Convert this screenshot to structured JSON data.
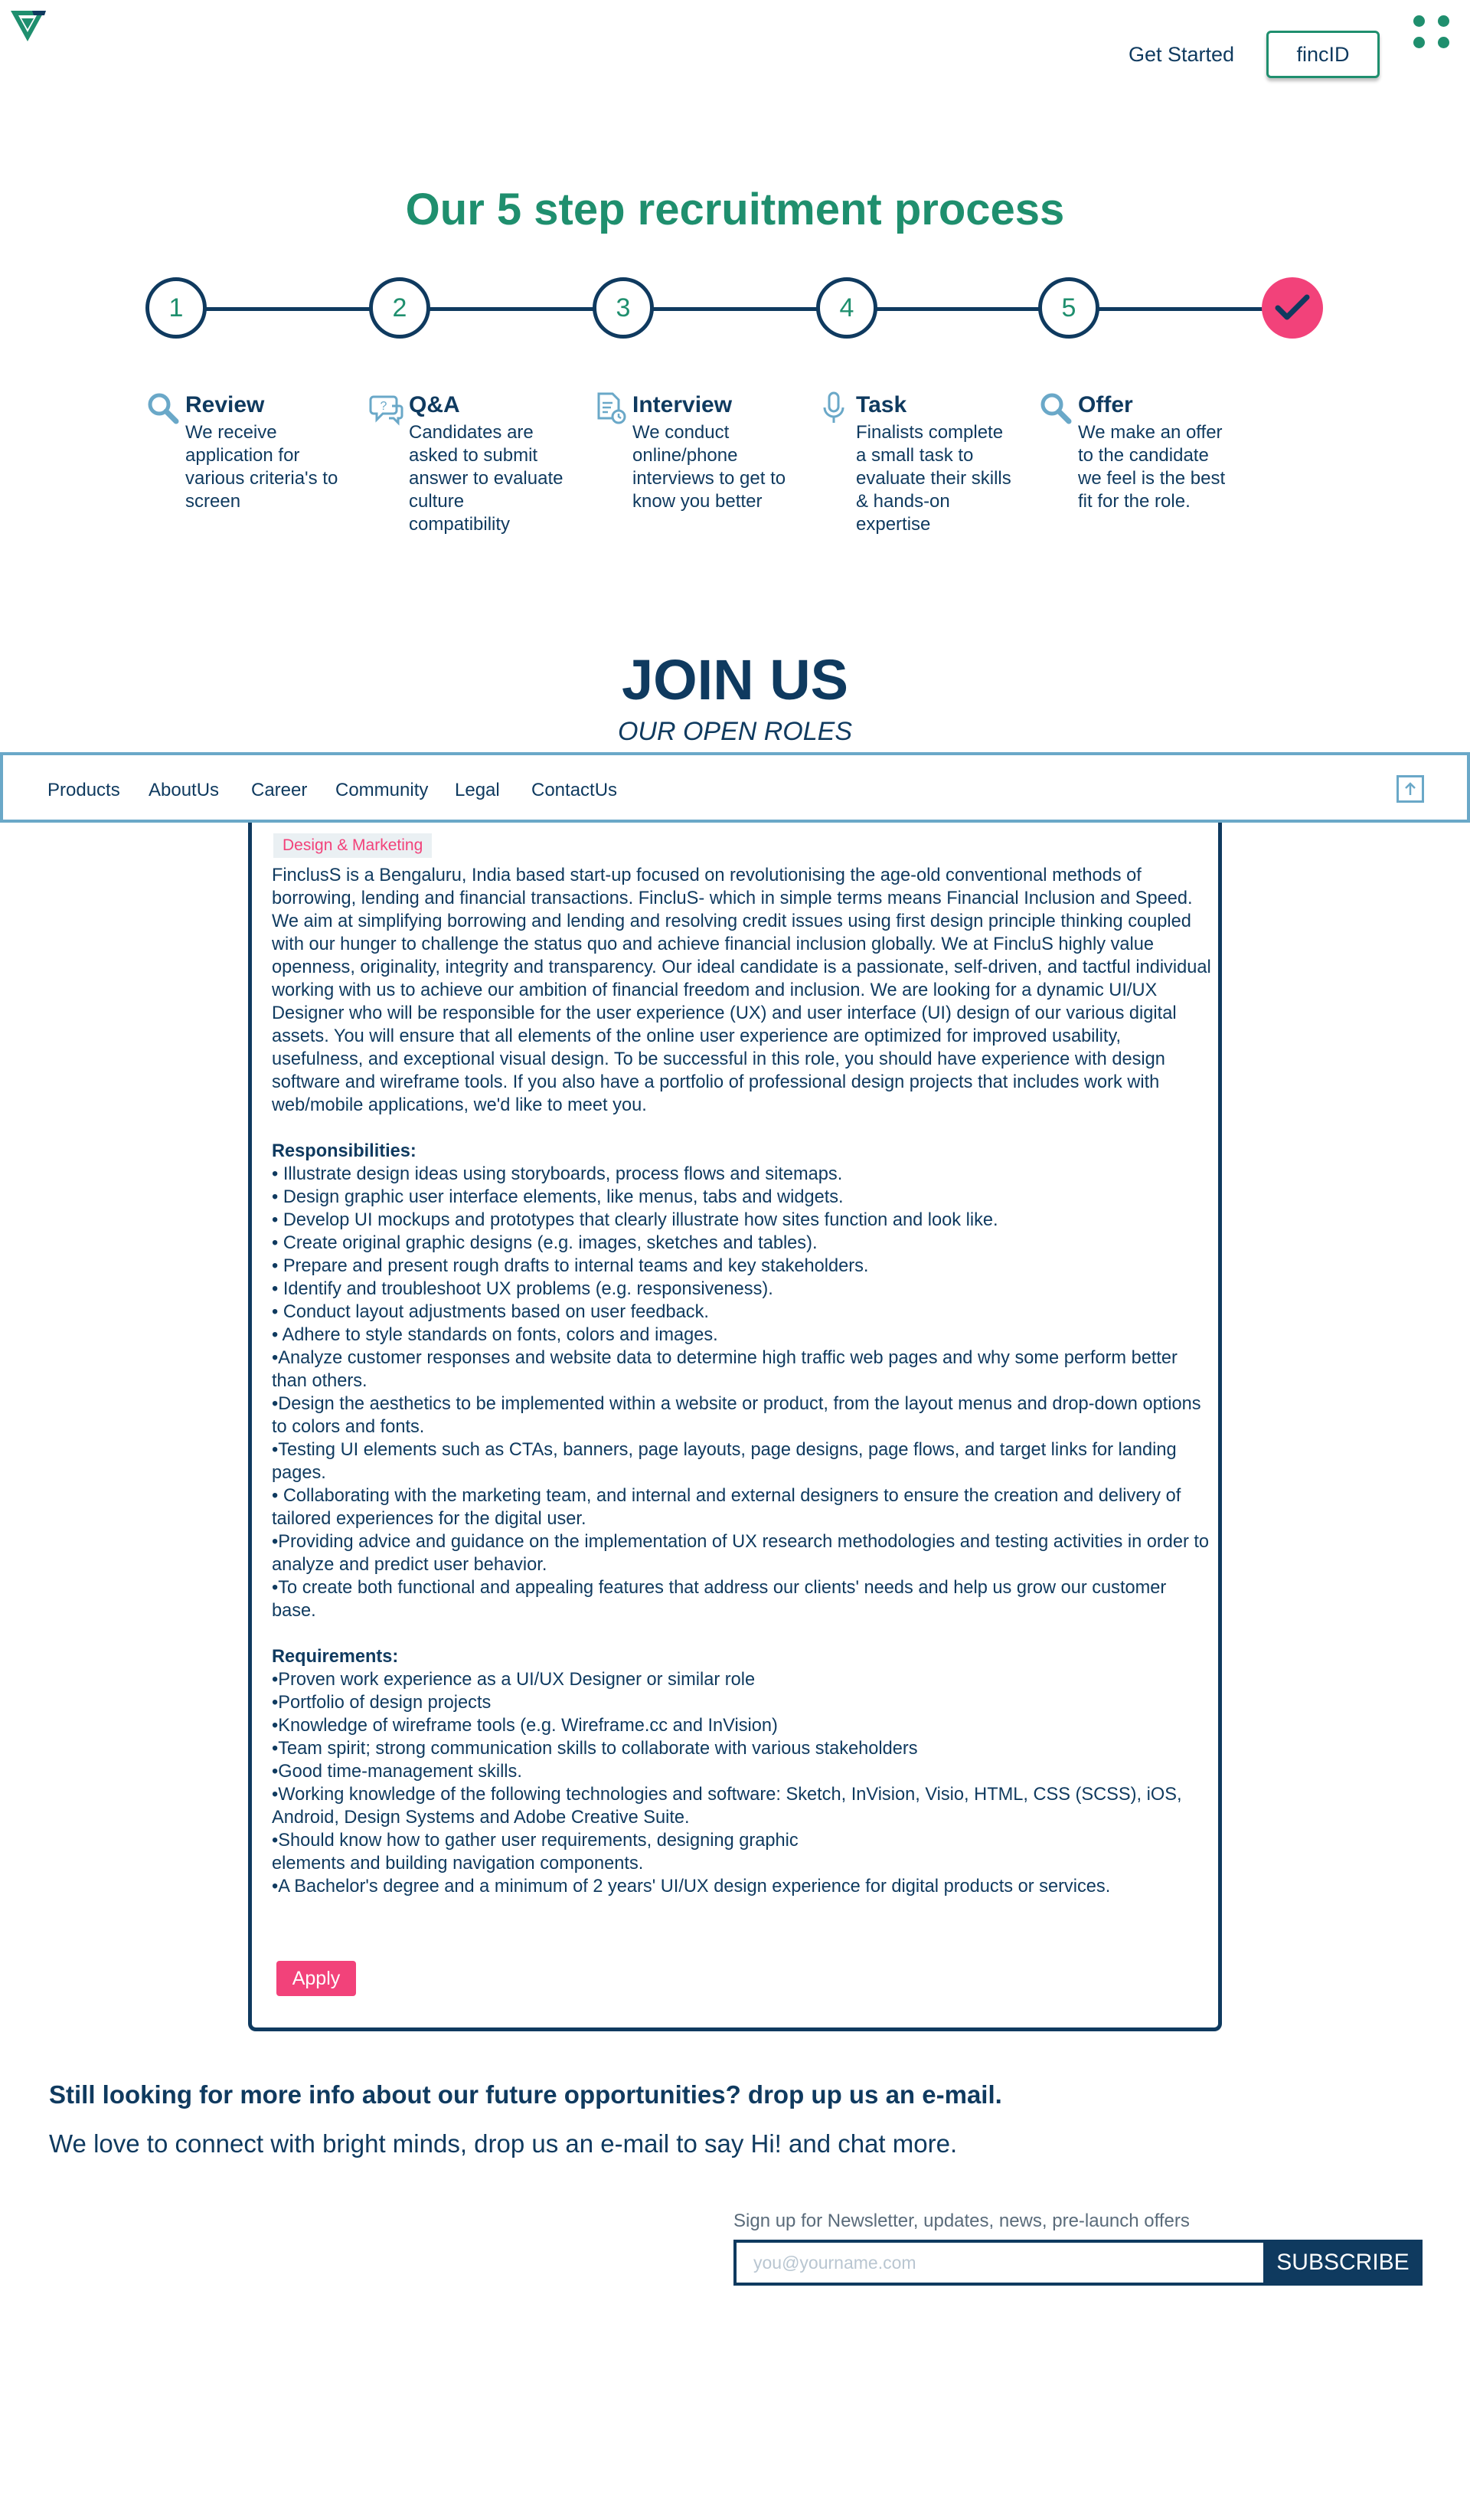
{
  "header": {
    "get_started": "Get Started",
    "fincid_button": "fincID",
    "brand_color": "#1f8f6e",
    "navy_color": "#0f3a5f"
  },
  "process": {
    "title": "Our 5 step recruitment process",
    "steps": [
      {
        "number": "1",
        "name": "Review",
        "icon": "search-icon",
        "description": "We receive application for various criteria's to screen"
      },
      {
        "number": "2",
        "name": "Q&A",
        "icon": "question-chat-icon",
        "description": "Candidates are asked to submit answer to evaluate culture compatibility"
      },
      {
        "number": "3",
        "name": "Interview",
        "icon": "document-clock-icon",
        "description": "We conduct online/phone interviews to get to know you better"
      },
      {
        "number": "4",
        "name": "Task",
        "icon": "microphone-icon",
        "description": "Finalists complete a small task to evaluate their skills & hands-on expertise"
      },
      {
        "number": "5",
        "name": "Offer",
        "icon": "search-icon",
        "description": "We make an offer to the candidate we feel is the best fit for the role."
      }
    ],
    "final_icon": "checkmark-icon",
    "accent_color": "#f2427a"
  },
  "join": {
    "title": "JOIN US",
    "subtitle": "OUR OPEN ROLES"
  },
  "nav": {
    "items": [
      "Products",
      "AboutUs",
      "Career",
      "Community",
      "Legal",
      "ContactUs"
    ],
    "scroll_top_icon": "arrow-up-icon"
  },
  "job": {
    "tag": "Design & Marketing",
    "intro": "FinclusS is a Bengaluru, India based start-up focused on revolutionising the age-old conventional methods of borrowing, lending and financial transactions. FincluS- which in simple terms means Financial Inclusion and Speed. We aim at simplifying borrowing and lending and resolving credit issues using first design principle thinking coupled with our hunger to challenge the status quo and achieve financial inclusion globally. We at FincluS highly value openness, originality, integrity and transparency. Our ideal candidate is a passionate, self-driven, and tactful individual working with us to achieve our ambition of financial freedom and inclusion. We are looking for a dynamic UI/UX Designer who will be responsible for the user experience (UX) and user interface (UI) design of our various digital assets. You will ensure that all elements of the online user experience are optimized for improved usability, usefulness, and exceptional visual design. To be successful in this role, you should have experience with design software and wireframe tools. If you also have a portfolio of professional design projects that includes work with web/mobile applications, we'd like to meet you.",
    "responsibilities_title": "Responsibilities:",
    "responsibilities": [
      "•   Illustrate design ideas using storyboards, process flows and sitemaps.",
      "• Design graphic user interface elements, like menus, tabs and widgets.",
      "• Develop UI mockups and prototypes that clearly illustrate how sites function and look like.",
      "• Create original graphic designs (e.g. images, sketches and tables).",
      "• Prepare and present rough drafts to internal teams and key stakeholders.",
      "• Identify and troubleshoot UX problems (e.g. responsiveness).",
      "• Conduct layout adjustments based on user feedback.",
      "• Adhere to style standards on fonts, colors and images.",
      "•Analyze customer responses and website data to determine high traffic web pages and why some perform better than others.",
      "•Design the aesthetics to be implemented within a website or product, from the layout menus and drop-down options to colors and fonts.",
      "•Testing UI elements such as CTAs, banners, page layouts, page designs, page flows, and target links for landing pages.",
      "• Collaborating with the marketing team, and internal and external designers to ensure the creation and delivery of tailored experiences for the digital user.",
      "•Providing advice and guidance on the implementation of UX research methodologies and testing activities in order to analyze and predict user behavior.",
      "•To create both functional and appealing features that address our clients' needs and help us grow our customer base."
    ],
    "requirements_title": "Requirements:",
    "requirements": [
      "•Proven work experience as a UI/UX Designer or similar role",
      "•Portfolio of design projects",
      "•Knowledge of wireframe tools (e.g. Wireframe.cc and InVision)",
      "•Team spirit; strong communication skills to collaborate with various stakeholders",
      "•Good time-management skills.",
      "•Working knowledge of the following technologies and software: Sketch, InVision, Visio, HTML, CSS (SCSS), iOS, Android, Design Systems and Adobe Creative Suite.",
      "•Should know how to gather user requirements, designing graphic\nelements and building navigation components.",
      "•A Bachelor's degree and a minimum of 2 years' UI/UX design experience for digital products or services."
    ],
    "apply": "Apply"
  },
  "contact": {
    "more_info": "Still looking for more info about our future opportunities? drop up us an e-mail.",
    "connect": "We love to connect with bright minds, drop us an e-mail to say Hi! and chat more."
  },
  "newsletter": {
    "label": "Sign up for Newsletter, updates, news, pre-launch offers",
    "placeholder": "you@yourname.com",
    "value": "",
    "subscribe": "SUBSCRIBE"
  }
}
